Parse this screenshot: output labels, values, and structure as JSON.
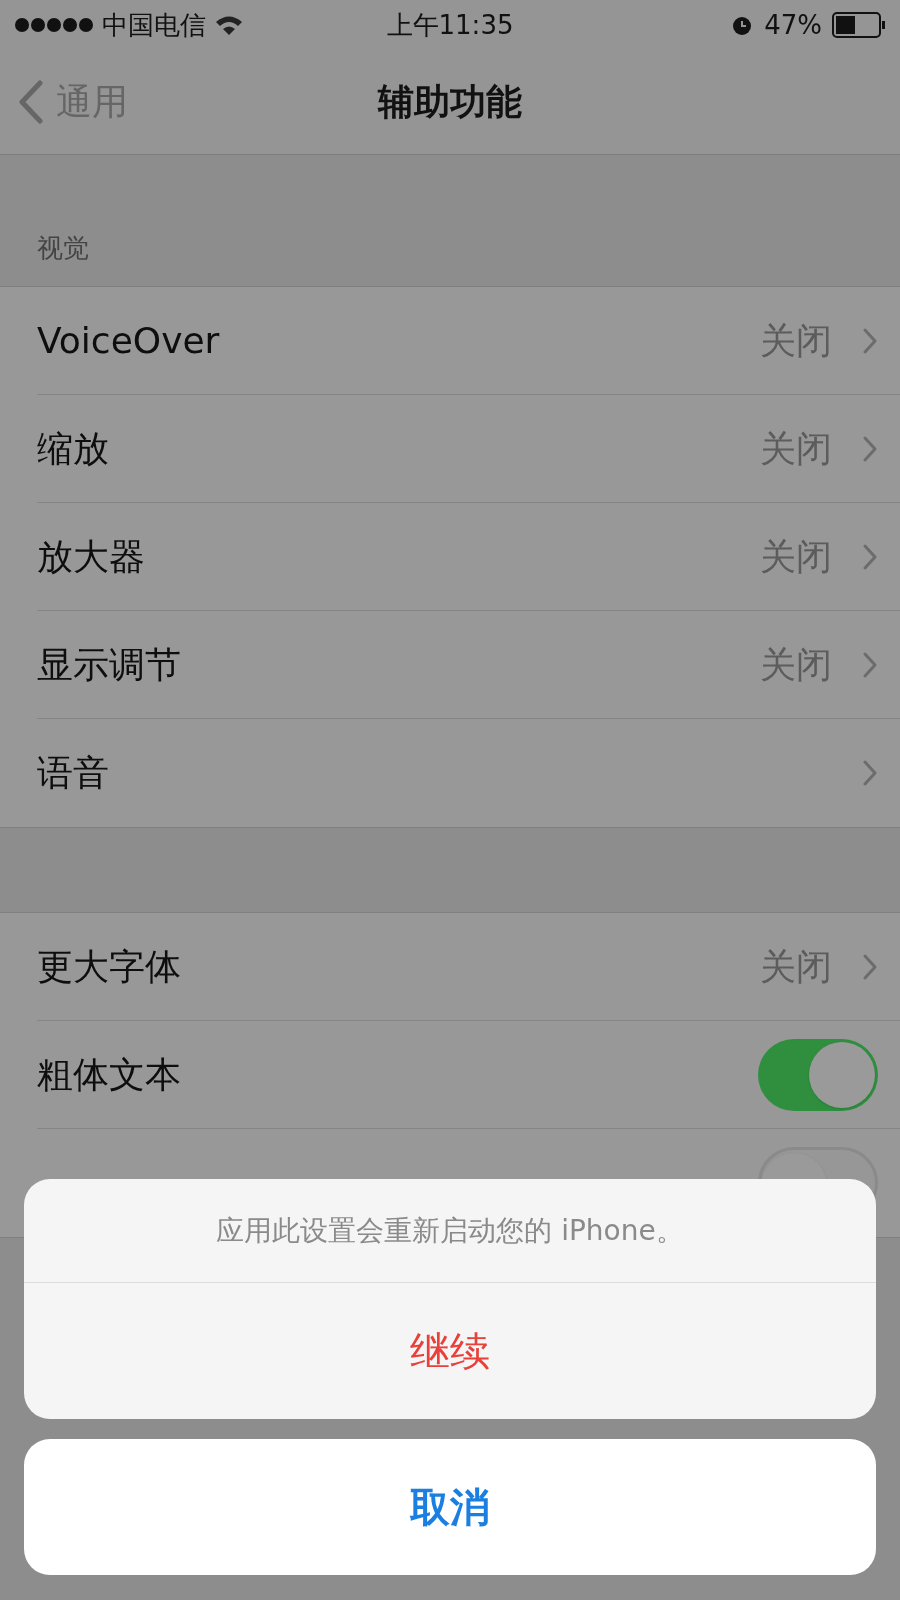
{
  "status_bar": {
    "carrier": "中国电信",
    "time": "上午11:35",
    "battery": "47%"
  },
  "nav": {
    "back": "通用",
    "title": "辅助功能"
  },
  "sections": [
    {
      "header": "视觉",
      "rows": [
        {
          "kind": "link",
          "label": "VoiceOver",
          "value": "关闭"
        },
        {
          "kind": "link",
          "label": "缩放",
          "value": "关闭"
        },
        {
          "kind": "link",
          "label": "放大器",
          "value": "关闭"
        },
        {
          "kind": "link",
          "label": "显示调节",
          "value": "关闭"
        },
        {
          "kind": "link",
          "label": "语音"
        }
      ]
    },
    {
      "rows": [
        {
          "kind": "link",
          "label": "更大字体",
          "value": "关闭"
        },
        {
          "kind": "toggle",
          "label": "粗体文本",
          "on": true
        },
        {
          "kind": "toggle",
          "on": false
        }
      ]
    }
  ],
  "action_sheet": {
    "message": "应用此设置会重新启动您的 iPhone。",
    "action": "继续",
    "cancel": "取消"
  }
}
